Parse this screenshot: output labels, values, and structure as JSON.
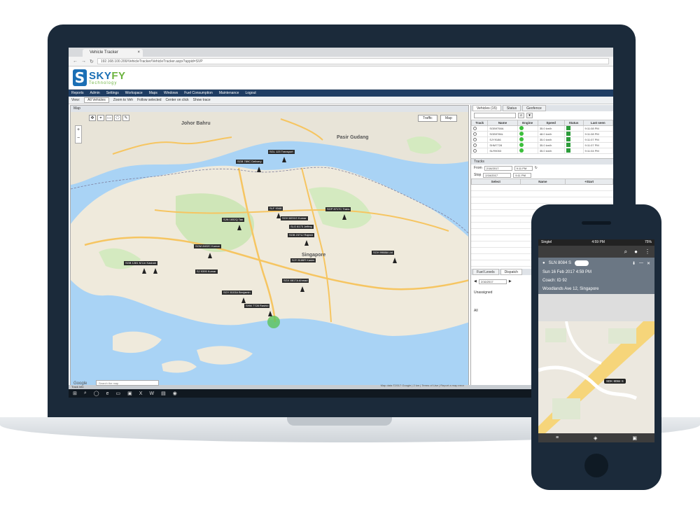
{
  "browser": {
    "tab_title": "Vehicle Tracker",
    "address": "192.168.100.200/VehicleTracker/VehicleTracker.aspx?appid=SVP"
  },
  "brand": {
    "name_a": "SKY",
    "name_b": "FY",
    "tagline": "Technology"
  },
  "menu": [
    "Reports",
    "Admin",
    "Settings",
    "Workspace",
    "Maps",
    "Windows",
    "Fuel Consumption",
    "Maintenance",
    "Logout"
  ],
  "toolbar": {
    "view_label": "View:",
    "vehicle_select": "All Vehicles",
    "items": [
      "Zoom to Veh",
      "Follow selected",
      "Center on click",
      "Show trace"
    ]
  },
  "map": {
    "panel_title": "Map",
    "type_traffic": "Traffic",
    "type_map": "Map",
    "search_placeholder": "Search the map",
    "google": "Google",
    "copyright": "Map data ©2017 Google | 2 km | Terms of Use | Report a map error",
    "places": {
      "johor_bahru": "Johor Bahru",
      "singapore": "Singapore",
      "pasir_gudang": "Pasir Gudang"
    },
    "vehicles": [
      "SGL 123 Transport",
      "SGB 789C Delivery",
      "SLF 9348",
      "SJN 1652Q Tan",
      "SGP 8717C Trans",
      "SGH 6031G Kumar",
      "SLG 8173 Jeffery",
      "SGB 2371J Rajesh",
      "SGM 8402C Kumar",
      "SGH 9988A Ltd",
      "SJY 8186R Kasim",
      "SGX 8817A Ahmad",
      "SGY 8103A Benjamin",
      "SHM 7728 Rashid",
      "SGB 1281 M Lin Kasbah",
      "SJ 9395 Kumar"
    ]
  },
  "side_panel": {
    "tabs": [
      "Vehicles (15)",
      "Status",
      "Geofence"
    ],
    "columns": [
      "Track",
      "Name",
      "Engine",
      "Speed",
      "Status",
      "Last seen"
    ],
    "rows": [
      {
        "name": "SGB9758A",
        "speed": "35.0 km/h",
        "last": "9:11:08 PM"
      },
      {
        "name": "SGB9786L",
        "speed": "48.0 km/h",
        "last": "9:11:08 PM"
      },
      {
        "name": "SJY9186",
        "speed": "35.0 km/h",
        "last": "9:11:07 PM"
      },
      {
        "name": "SHM7728",
        "speed": "35.0 km/h",
        "last": "9:11:07 PM"
      },
      {
        "name": "SLR9053",
        "speed": "35.0 km/h",
        "last": "9:11:04 PM"
      }
    ],
    "tracks_title": "Tracks",
    "from_label": "From",
    "from_date": "2/16/2017",
    "from_time": "9:11 PM",
    "to_label": "Stop",
    "to_date": "2/16/2017",
    "to_time": "9:11 PM",
    "tracks_columns": [
      "Select",
      "Name",
      "+Start"
    ],
    "lower_tabs": [
      "Fuel Levels",
      "Dispatch"
    ],
    "dispatch_date": "2/16/2017",
    "unassigned": "Unassigned",
    "all": "All"
  },
  "status_strip": "Track info",
  "phone": {
    "time": "4:59 PM",
    "carrier": "Singtel",
    "battery": "75%",
    "vehicle": "SLN 8084 S",
    "line1": "Sun 16 Feb 2017 4:59 PM",
    "line2": "Coach: ID 92",
    "line3": "Woodlands Ave 12, Singapore",
    "map_tag": "SDK 8084 S"
  }
}
